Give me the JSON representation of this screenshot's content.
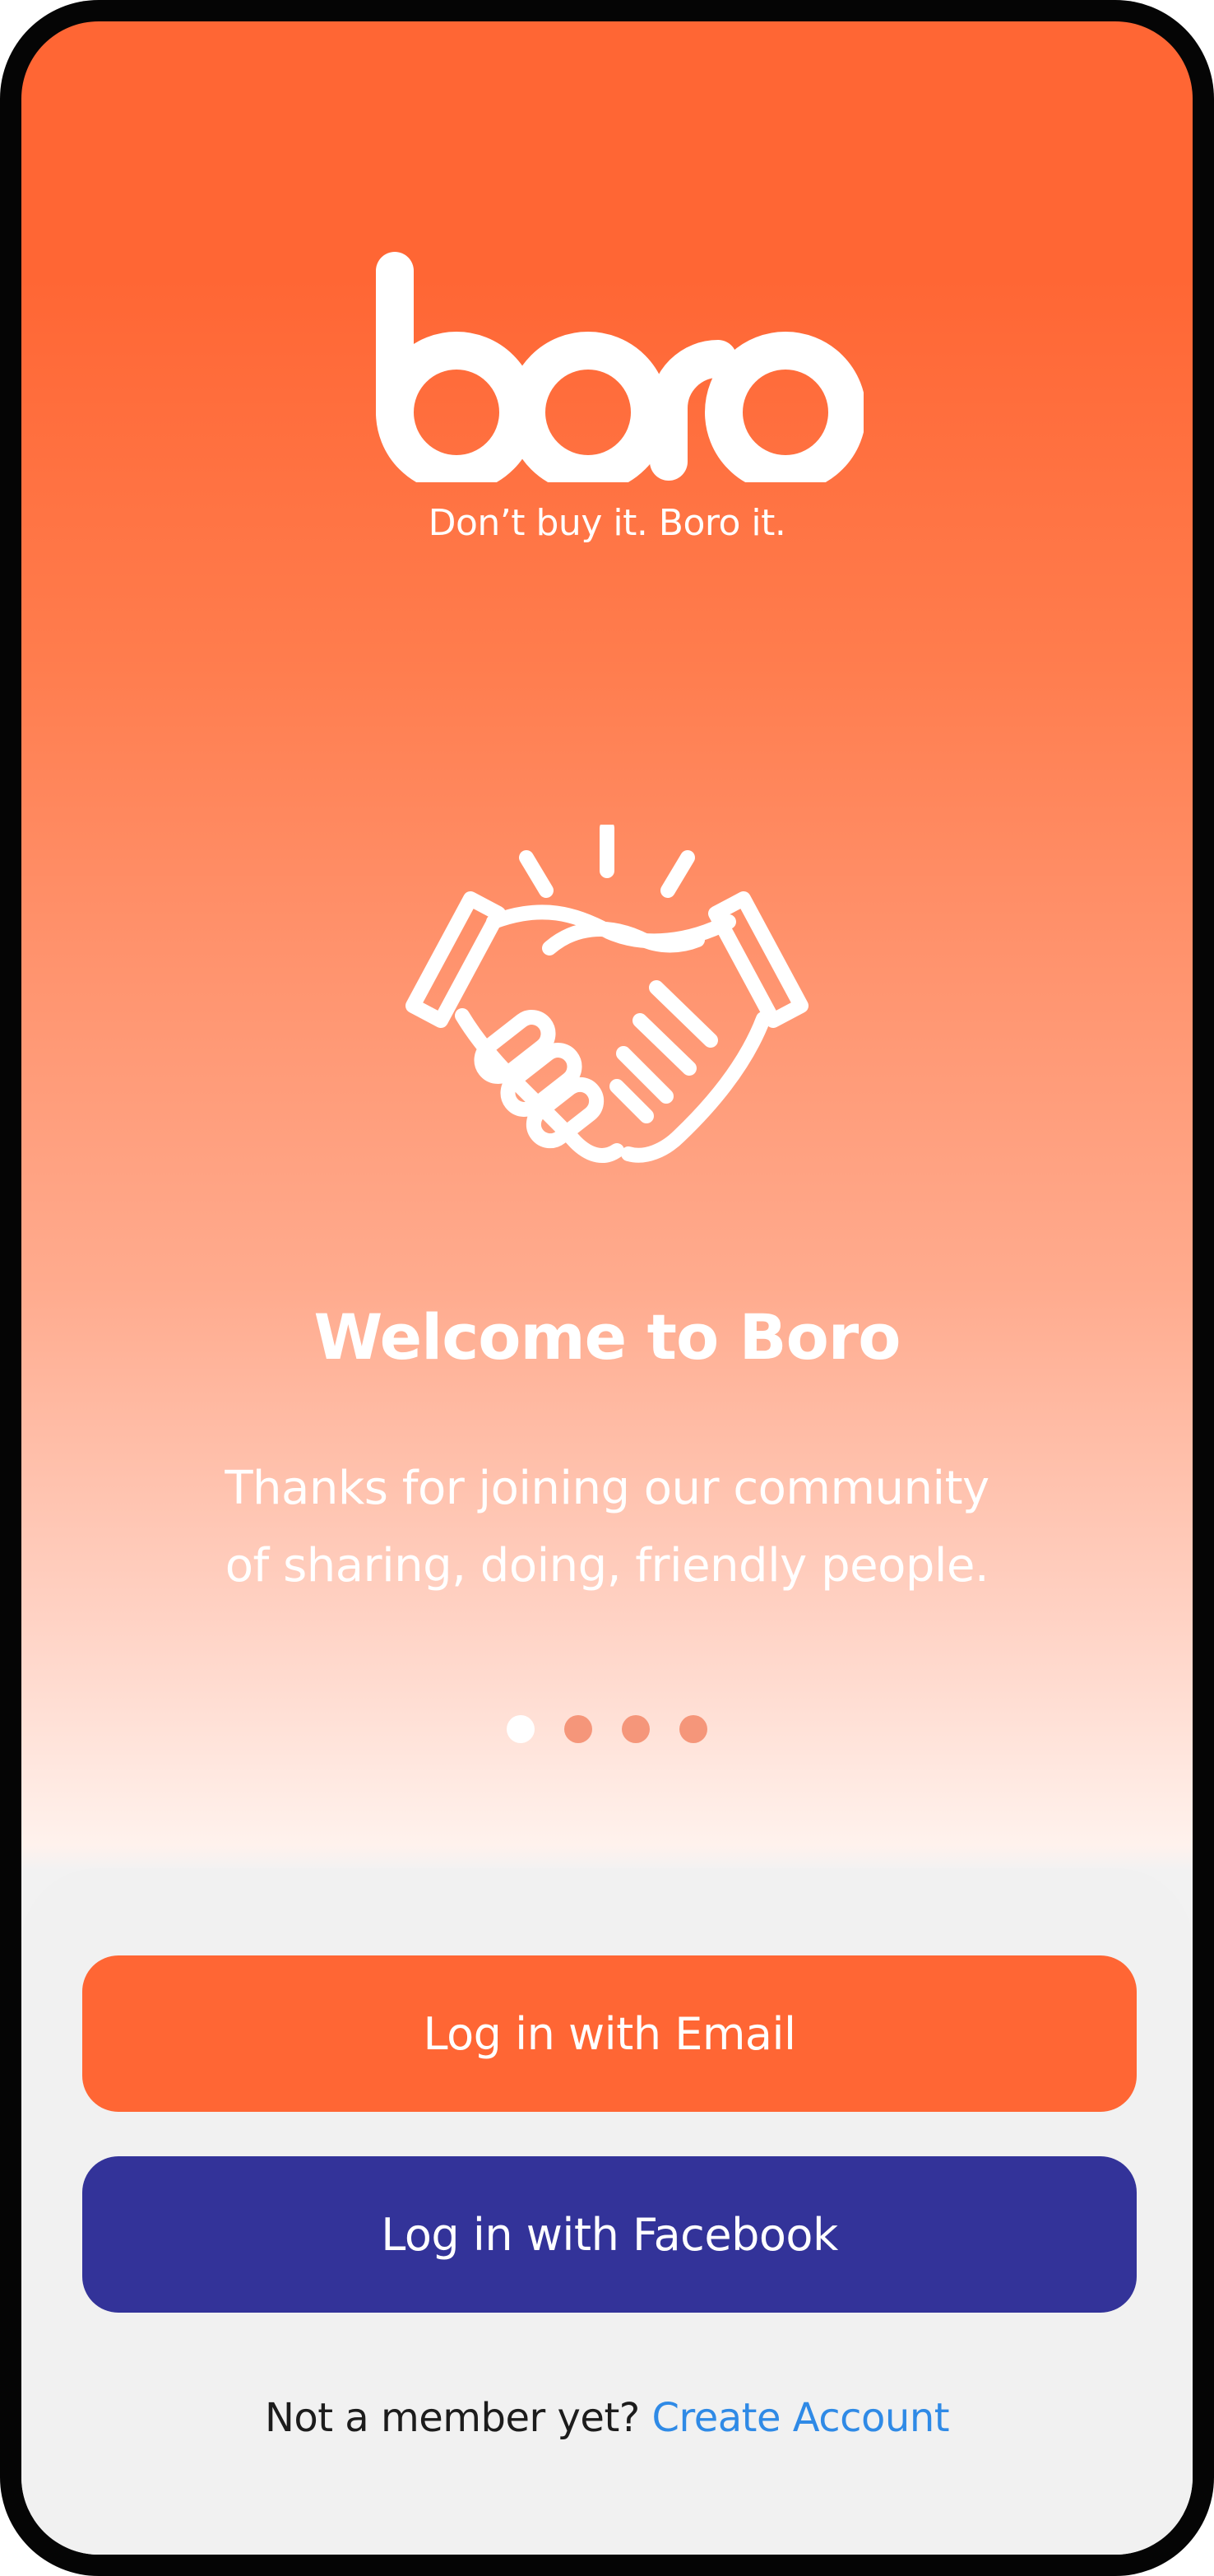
{
  "app": {
    "name": "boro",
    "tagline": "Don’t buy it. Boro it."
  },
  "onboarding": {
    "illustration_icon": "handshake-icon",
    "title": "Welcome to Boro",
    "body_line1": "Thanks for joining our community",
    "body_line2": "of sharing, doing, friendly people.",
    "pager": {
      "total": 4,
      "active_index": 0
    }
  },
  "actions": {
    "email_button_label": "Log in with Email",
    "facebook_button_label": "Log in with Facebook",
    "signup_prompt": "Not a member yet?",
    "signup_link_label": "Create Account"
  },
  "colors": {
    "brand_orange": "#ff6634",
    "facebook_blue": "#333399",
    "link_blue": "#2f8ae6",
    "sheet_background": "#f1f1f1"
  }
}
